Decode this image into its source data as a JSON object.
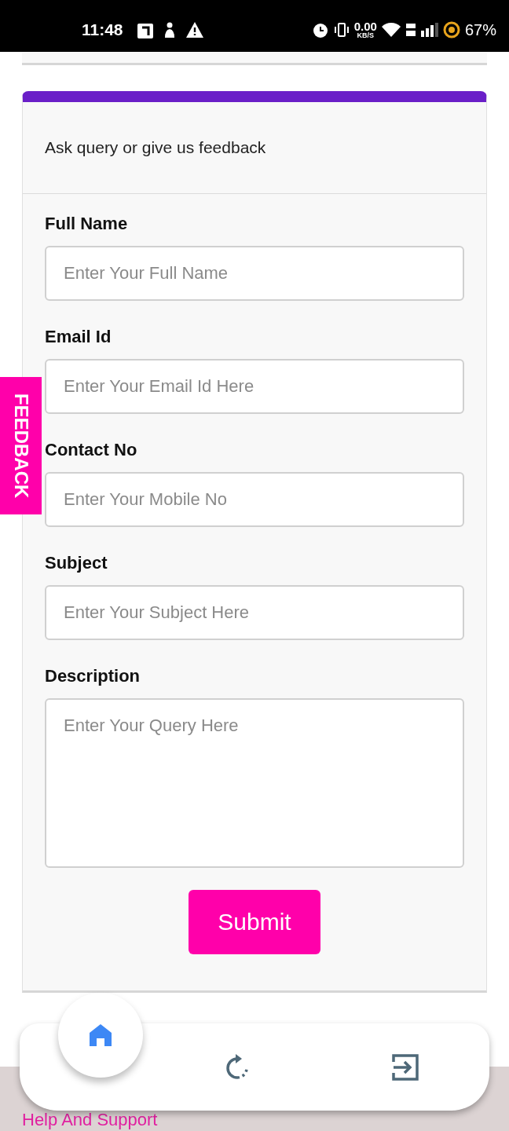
{
  "status_bar": {
    "time": "11:48",
    "data_speed": "0.00",
    "data_unit": "KB/S",
    "battery": "67%"
  },
  "form_card": {
    "heading": "Ask query or give us feedback",
    "fields": [
      {
        "label": "Full Name",
        "placeholder": "Enter Your Full Name",
        "kind": "input"
      },
      {
        "label": "Email Id",
        "placeholder": "Enter Your Email Id Here",
        "kind": "input"
      },
      {
        "label": "Contact No",
        "placeholder": "Enter Your Mobile No",
        "kind": "input"
      },
      {
        "label": "Subject",
        "placeholder": "Enter Your Subject Here",
        "kind": "input"
      },
      {
        "label": "Description",
        "placeholder": "Enter Your Query Here",
        "kind": "textarea"
      }
    ],
    "submit": "Submit"
  },
  "feedback_tab": "FEEDBACK",
  "footer_link": "Help And Support",
  "bottom_nav": [
    {
      "kind": "home",
      "selected": true
    },
    {
      "kind": "refresh",
      "selected": false
    },
    {
      "kind": "exit",
      "selected": false
    }
  ]
}
